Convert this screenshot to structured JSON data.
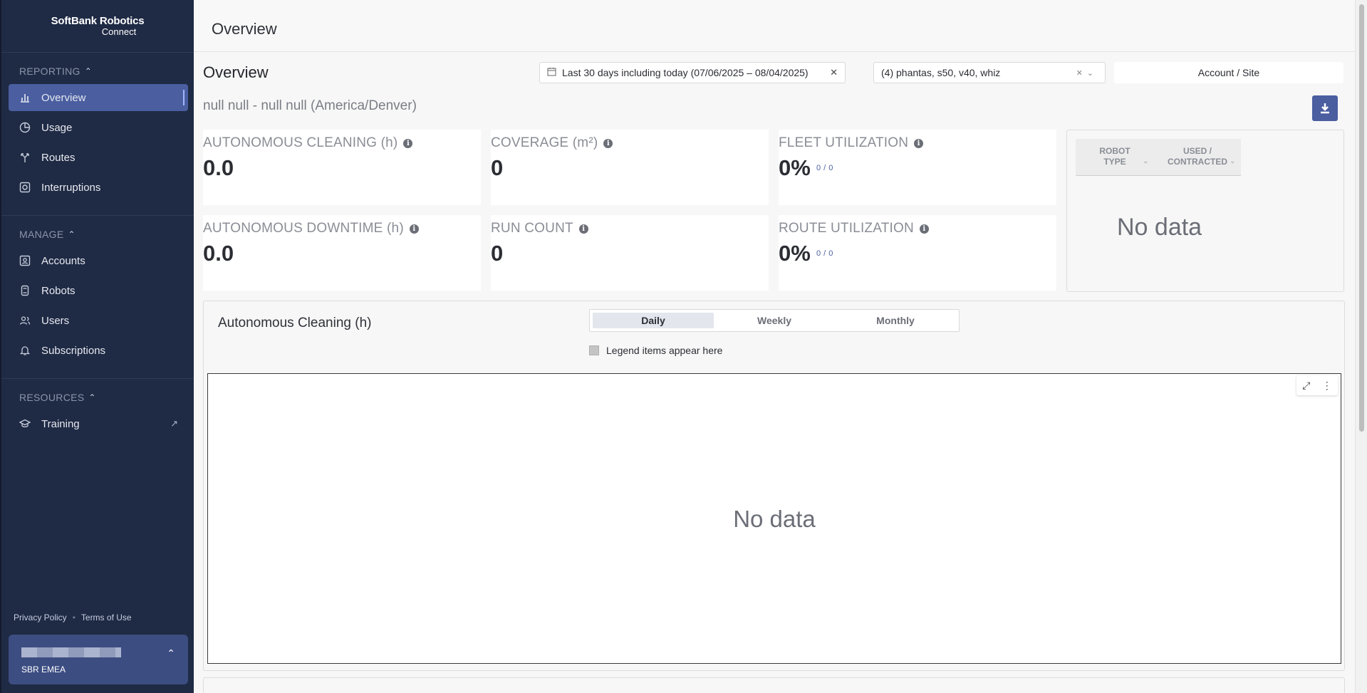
{
  "app": {
    "brand_line1": "SoftBank Robotics",
    "brand_line2": "Connect"
  },
  "sidebar": {
    "sections": [
      {
        "title": "REPORTING",
        "items": [
          {
            "label": "Overview",
            "icon": "bar-chart-icon",
            "active": true
          },
          {
            "label": "Usage",
            "icon": "pie-chart-icon"
          },
          {
            "label": "Routes",
            "icon": "route-fork-icon"
          },
          {
            "label": "Interruptions",
            "icon": "interruption-icon"
          }
        ]
      },
      {
        "title": "MANAGE",
        "items": [
          {
            "label": "Accounts",
            "icon": "account-icon"
          },
          {
            "label": "Robots",
            "icon": "robot-icon"
          },
          {
            "label": "Users",
            "icon": "users-icon"
          },
          {
            "label": "Subscriptions",
            "icon": "bell-icon"
          }
        ]
      },
      {
        "title": "RESOURCES",
        "items": [
          {
            "label": "Training",
            "icon": "graduation-cap-icon",
            "external_icon": "external-link-icon"
          }
        ]
      }
    ],
    "footer": {
      "privacy": "Privacy Policy",
      "separator": "•",
      "terms": "Terms of Use"
    },
    "user": {
      "org": "SBR EMEA"
    }
  },
  "header": {
    "title": "Overview"
  },
  "main": {
    "page_title": "Overview",
    "date_filter": "Last 30 days including today (07/06/2025 – 08/04/2025)",
    "robot_filter": "(4) phantas, s50, v40, whiz",
    "account_filter": "Account / Site",
    "subtitle": "null null - null null (America/Denver)",
    "kpis": {
      "autonomous_cleaning": {
        "label": "AUTONOMOUS CLEANING (h)",
        "value": "0.0"
      },
      "coverage": {
        "label": "COVERAGE (m²)",
        "value": "0"
      },
      "fleet_utilization": {
        "label": "FLEET UTILIZATION",
        "value": "0%",
        "sub": "0 / 0"
      },
      "autonomous_downtime": {
        "label": "AUTONOMOUS DOWNTIME (h)",
        "value": "0.0"
      },
      "run_count": {
        "label": "RUN COUNT",
        "value": "0"
      },
      "route_utilization": {
        "label": "ROUTE UTILIZATION",
        "value": "0%",
        "sub": "0 / 0"
      }
    },
    "robot_table": {
      "col1": [
        "ROBOT",
        "TYPE"
      ],
      "col2": [
        "USED /",
        "CONTRACTED"
      ],
      "empty": "No data"
    },
    "chart": {
      "title": "Autonomous Cleaning (h)",
      "tabs": [
        "Daily",
        "Weekly",
        "Monthly"
      ],
      "active_tab": "Daily",
      "legend": "Legend items appear here",
      "empty": "No data"
    }
  }
}
